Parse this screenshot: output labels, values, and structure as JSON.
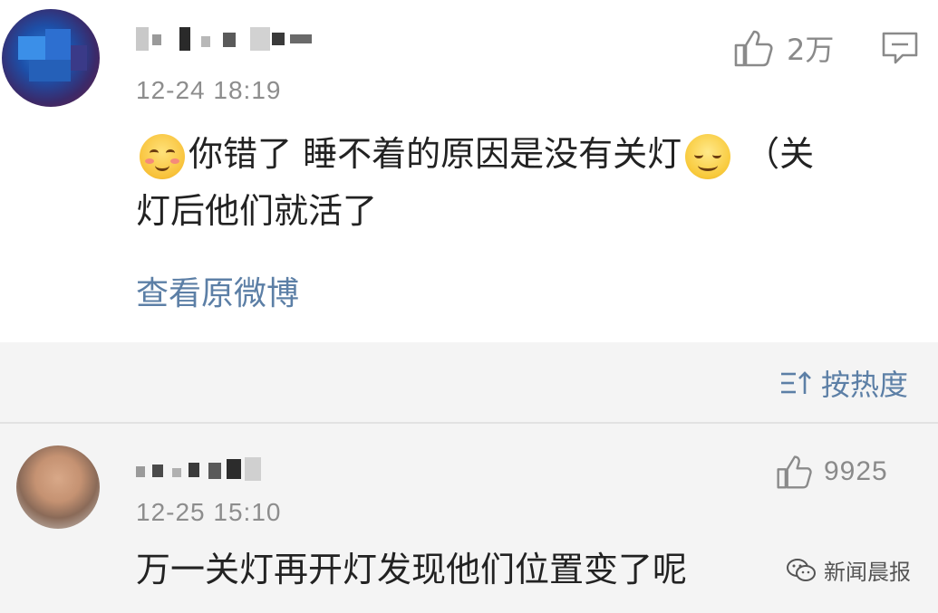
{
  "comments": [
    {
      "time": "12-24 18:19",
      "text_line1_a": "你错了 睡不着的原因是没有关灯",
      "text_line1_b": "（关",
      "text_line2": "灯后他们就活了",
      "like_count": "2万",
      "link": "查看原微博",
      "emojis": [
        "blush-emoji",
        "smirk-emoji"
      ],
      "username_blurred": true
    },
    {
      "time": "12-25 15:10",
      "text": "万一关灯再开灯发现他们位置变了呢",
      "like_count": "9925",
      "username_blurred": true
    }
  ],
  "sort": {
    "label": "按热度",
    "icon": "sort-icon"
  },
  "watermark": {
    "text": "新闻晨报",
    "icon": "wechat-icon"
  },
  "colors": {
    "link": "#5c7fa6",
    "meta": "#8d8d8d",
    "icon": "#8a8a8a",
    "divider": "#e2e2e2",
    "section_bg": "#f4f4f4"
  }
}
